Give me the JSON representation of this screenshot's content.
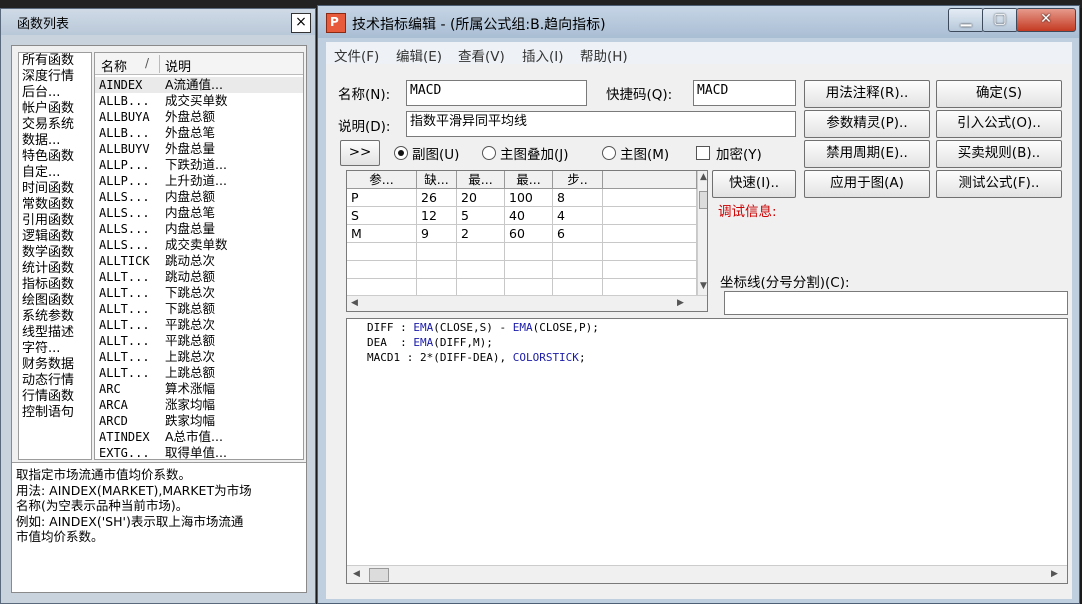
{
  "left_window": {
    "title": "函数列表",
    "close_glyph": "×",
    "categories": [
      "所有函数",
      "深度行情",
      "后台...",
      "帐户函数",
      "交易系统",
      "数据...",
      "特色函数",
      "自定...",
      "时间函数",
      "常数函数",
      "引用函数",
      "逻辑函数",
      "数学函数",
      "统计函数",
      "指标函数",
      "绘图函数",
      "系统参数",
      "线型描述",
      "字符...",
      "财务数据",
      "动态行情",
      "行情函数",
      "控制语句"
    ],
    "col_name": "名称",
    "col_sort": "/",
    "col_desc": "说明",
    "functions": [
      {
        "name": "AINDEX",
        "desc": "A流通值..."
      },
      {
        "name": "ALLB...",
        "desc": "成交买单数"
      },
      {
        "name": "ALLBUYA",
        "desc": "外盘总额"
      },
      {
        "name": "ALLB...",
        "desc": "外盘总笔"
      },
      {
        "name": "ALLBUYV",
        "desc": "外盘总量"
      },
      {
        "name": "ALLP...",
        "desc": "下跌劲道..."
      },
      {
        "name": "ALLP...",
        "desc": "上升劲道..."
      },
      {
        "name": "ALLS...",
        "desc": "内盘总额"
      },
      {
        "name": "ALLS...",
        "desc": "内盘总笔"
      },
      {
        "name": "ALLS...",
        "desc": "内盘总量"
      },
      {
        "name": "ALLS...",
        "desc": "成交卖单数"
      },
      {
        "name": "ALLTICK",
        "desc": "跳动总次"
      },
      {
        "name": "ALLT...",
        "desc": "跳动总额"
      },
      {
        "name": "ALLT...",
        "desc": "下跳总次"
      },
      {
        "name": "ALLT...",
        "desc": "下跳总额"
      },
      {
        "name": "ALLT...",
        "desc": "平跳总次"
      },
      {
        "name": "ALLT...",
        "desc": "平跳总额"
      },
      {
        "name": "ALLT...",
        "desc": "上跳总次"
      },
      {
        "name": "ALLT...",
        "desc": "上跳总额"
      },
      {
        "name": "ARC",
        "desc": "算术涨幅"
      },
      {
        "name": "ARCA",
        "desc": "涨家均幅"
      },
      {
        "name": "ARCD",
        "desc": "跌家均幅"
      },
      {
        "name": "ATINDEX",
        "desc": "A总市值..."
      },
      {
        "name": "EXTG...",
        "desc": "取得单值..."
      }
    ],
    "description_lines": [
      "取指定市场流通市值均价系数。",
      "用法: AINDEX(MARKET),MARKET为市场",
      "名称(为空表示品种当前市场)。",
      "例如: AINDEX('SH')表示取上海市场流通",
      "市值均价系数。"
    ]
  },
  "main_window": {
    "title": "技术指标编辑 - (所属公式组:B.趋向指标)",
    "icon_glyph": "P",
    "min_glyph": "▁",
    "max_glyph": "▢",
    "close_glyph": "✕",
    "menus": [
      "文件(F)",
      "编辑(E)",
      "查看(V)",
      "插入(I)",
      "帮助(H)"
    ],
    "name_label": "名称(N):",
    "name_value": "MACD",
    "shortcut_label": "快捷码(Q):",
    "shortcut_value": "MACD",
    "desc_label": "说明(D):",
    "desc_value": "指数平滑异同平均线",
    "expand_button": ">>",
    "radio_sub": "副图(U)",
    "radio_overlay": "主图叠加(J)",
    "radio_main": "主图(M)",
    "encrypt_label": "加密(Y)",
    "grid_headers": [
      "参...",
      "缺...",
      "最...",
      "最...",
      "步.."
    ],
    "grid_rows": [
      [
        "P",
        "26",
        "20",
        "100",
        "8"
      ],
      [
        "S",
        "12",
        "5",
        "40",
        "4"
      ],
      [
        "M",
        "9",
        "2",
        "60",
        "6"
      ]
    ],
    "buttons": {
      "usage_notes": "用法注释(R)..",
      "ok": "确定(S)",
      "param_wizard": "参数精灵(P)..",
      "import_formula": "引入公式(O)..",
      "disable_period": "禁用周期(E)..",
      "trade_rules": "买卖规则(B)..",
      "quick": "快速(I)..",
      "apply_chart": "应用于图(A)",
      "test_formula": "测试公式(F).."
    },
    "debug_label": "调试信息:",
    "coord_label": "坐标线(分号分割)(C):",
    "coord_value": "",
    "code_lines": [
      {
        "pre": "DIFF : ",
        "kw1": "EMA",
        "mid": "(CLOSE,S) - ",
        "kw2": "EMA",
        "post": "(CLOSE,P);"
      },
      {
        "pre": "DEA  : ",
        "kw1": "EMA",
        "mid": "(DIFF,M);",
        "kw2": "",
        "post": ""
      },
      {
        "pre": "MACD1 : 2*(DIFF-DEA), ",
        "kw1": "COLORSTICK",
        "mid": ";",
        "kw2": "",
        "post": ""
      }
    ]
  },
  "colors": {
    "debug_red": "#cc0000",
    "keyword_blue": "#1a1aa8"
  }
}
